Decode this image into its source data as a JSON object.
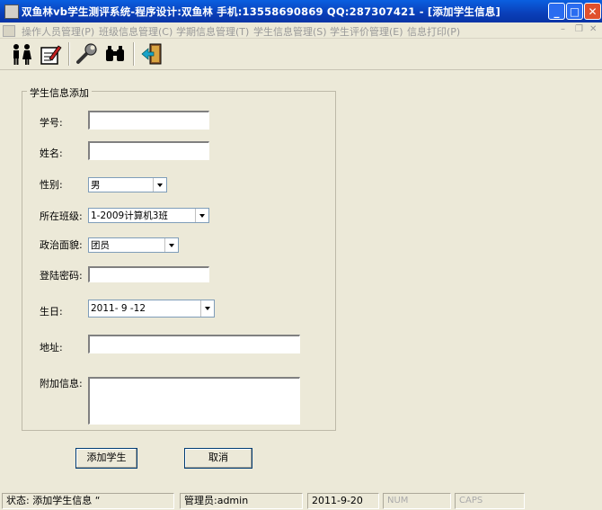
{
  "window": {
    "title": "双鱼林vb学生测评系统-程序设计:双鱼林 手机:13558690869 QQ:287307421 - [添加学生信息]",
    "controls": {
      "minimize": "_",
      "maximize": "□",
      "close": "✕"
    }
  },
  "menu": {
    "items": [
      {
        "label": "操作人员管理(P)"
      },
      {
        "label": "班级信息管理(C)"
      },
      {
        "label": "学期信息管理(T)"
      },
      {
        "label": "学生信息管理(S)"
      },
      {
        "label": "学生评价管理(E)"
      },
      {
        "label": "信息打印(P)"
      }
    ],
    "mdi": {
      "minimize": "–",
      "restore": "❐",
      "close": "✕"
    }
  },
  "toolbar": {
    "icons": [
      "users-icon",
      "edit-document-icon",
      "wrench-icon",
      "binoculars-icon",
      "exit-door-icon"
    ]
  },
  "form": {
    "group_title": "学生信息添加",
    "student_no": {
      "label": "学号:",
      "value": ""
    },
    "name": {
      "label": "姓名:",
      "value": ""
    },
    "gender": {
      "label": "性别:",
      "value": "男"
    },
    "class": {
      "label": "所在班级:",
      "value": "1-2009计算机3班"
    },
    "politics": {
      "label": "政治面貌:",
      "value": "团员"
    },
    "password": {
      "label": "登陆密码:",
      "value": ""
    },
    "birthday": {
      "label": "生日:",
      "value": "2011- 9 -12"
    },
    "address": {
      "label": "地址:",
      "value": ""
    },
    "extra": {
      "label": "附加信息:",
      "value": ""
    },
    "add_button": "添加学生",
    "cancel_button": "取消"
  },
  "status": {
    "state": "状态: 添加学生信息 “",
    "operator": "管理员:admin",
    "date": "2011-9-20",
    "num": "NUM",
    "caps": "CAPS"
  }
}
